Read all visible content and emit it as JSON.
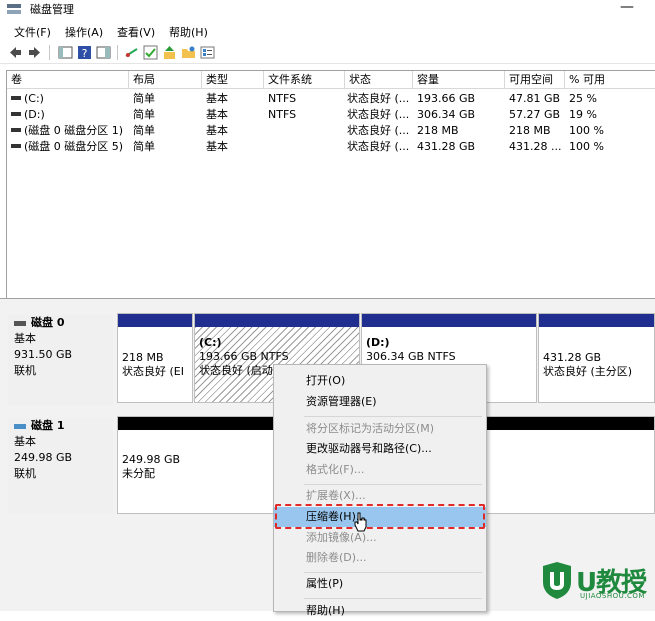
{
  "window": {
    "title": "磁盘管理",
    "minimize": "—"
  },
  "menu": [
    "文件(F)",
    "操作(A)",
    "查看(V)",
    "帮助(H)"
  ],
  "columns": [
    "卷",
    "布局",
    "类型",
    "文件系统",
    "状态",
    "容量",
    "可用空间",
    "% 可用"
  ],
  "volumes": [
    {
      "name": "(C:)",
      "layout": "简单",
      "type": "基本",
      "fs": "NTFS",
      "status": "状态良好 (...",
      "capacity": "193.66 GB",
      "free": "47.81 GB",
      "pct": "25 %"
    },
    {
      "name": "(D:)",
      "layout": "简单",
      "type": "基本",
      "fs": "NTFS",
      "status": "状态良好 (...",
      "capacity": "306.34 GB",
      "free": "57.27 GB",
      "pct": "19 %"
    },
    {
      "name": "(磁盘 0 磁盘分区 1)",
      "layout": "简单",
      "type": "基本",
      "fs": "",
      "status": "状态良好 (...",
      "capacity": "218 MB",
      "free": "218 MB",
      "pct": "100 %"
    },
    {
      "name": "(磁盘 0 磁盘分区 5)",
      "layout": "简单",
      "type": "基本",
      "fs": "",
      "status": "状态良好 (...",
      "capacity": "431.28 GB",
      "free": "431.28 ...",
      "pct": "100 %"
    }
  ],
  "disks": [
    {
      "label": "磁盘 0",
      "type": "基本",
      "size": "931.50 GB",
      "state": "联机",
      "partitions": [
        {
          "title": "",
          "line1": "218 MB",
          "line2": "状态良好 (EI"
        },
        {
          "title": "(C:)",
          "line1": "193.66 GB NTFS",
          "line2": "状态良好 (启动"
        },
        {
          "title": "(D:)",
          "line1": "306.34 GB NTFS",
          "line2": ""
        },
        {
          "title": "",
          "line1": "431.28 GB",
          "line2": "状态良好 (主分区)"
        }
      ]
    },
    {
      "label": "磁盘 1",
      "type": "基本",
      "size": "249.98 GB",
      "state": "联机",
      "partitions": [
        {
          "title": "",
          "line1": "249.98 GB",
          "line2": "未分配"
        }
      ]
    }
  ],
  "context_menu": {
    "open": "打开(O)",
    "explorer": "资源管理器(E)",
    "mark_active": "将分区标记为活动分区(M)",
    "change_letter": "更改驱动器号和路径(C)...",
    "format": "格式化(F)...",
    "extend": "扩展卷(X)...",
    "shrink": "压缩卷(H)...",
    "add_mirror": "添加镜像(A)...",
    "delete": "删除卷(D)...",
    "properties": "属性(P)",
    "help": "帮助(H)"
  },
  "watermark": {
    "brand": "U教授",
    "url": "UJIAOSHOU.COM"
  },
  "colors": {
    "partition_bar": "#1f2e8f",
    "unallocated_bar": "#000000",
    "highlight": "#99c6ee",
    "callout": "#e12b2b",
    "logo": "#1f8a3e"
  }
}
